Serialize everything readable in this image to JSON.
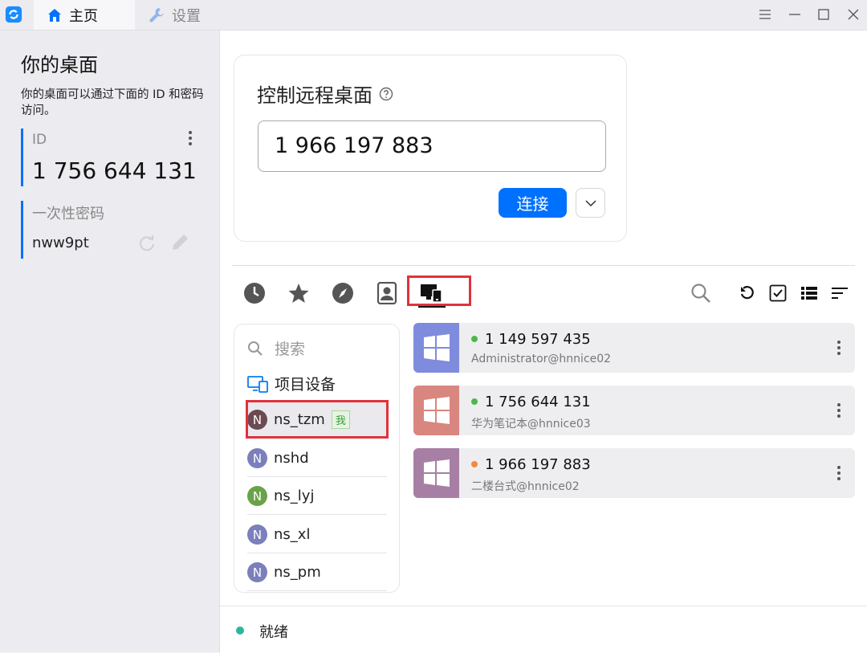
{
  "tabs": {
    "home": "主页",
    "settings": "设置"
  },
  "left": {
    "title": "你的桌面",
    "description": "你的桌面可以通过下面的 ID 和密码访问。",
    "id_label": "ID",
    "id_value": "1 756 644 131",
    "password_label": "一次性密码",
    "password_value": "nww9pt"
  },
  "connect": {
    "title": "控制远程桌面",
    "input_value": "1 966 197 883",
    "connect_label": "连接"
  },
  "group_list": {
    "search_placeholder": "搜索",
    "header": "项目设备",
    "me_badge": "我",
    "items": [
      {
        "initial": "N",
        "name": "ns_tzm",
        "color": "#6b4a52"
      },
      {
        "initial": "N",
        "name": "nshd",
        "color": "#7b7fbb"
      },
      {
        "initial": "N",
        "name": "ns_lyj",
        "color": "#6aa24a"
      },
      {
        "initial": "N",
        "name": "ns_xl",
        "color": "#7b7fbb"
      },
      {
        "initial": "N",
        "name": "ns_pm",
        "color": "#7b7fbb"
      }
    ]
  },
  "devices": [
    {
      "id": "1 149 597 435",
      "alias": "Administrator@hnnice02",
      "thumb_color": "#7f8bdc",
      "status_color": "#4cb84c"
    },
    {
      "id": "1 756 644 131",
      "alias": "华为笔记本@hnnice03",
      "thumb_color": "#d98680",
      "status_color": "#4cb84c"
    },
    {
      "id": "1 966 197 883",
      "alias": "二楼台式@hnnice02",
      "thumb_color": "#a87fa4",
      "status_color": "#f08a3c"
    }
  ],
  "status": {
    "text": "就绪",
    "color": "#2bb79a"
  },
  "colors": {
    "accent": "#0071ff",
    "highlight": "#e0323c"
  }
}
